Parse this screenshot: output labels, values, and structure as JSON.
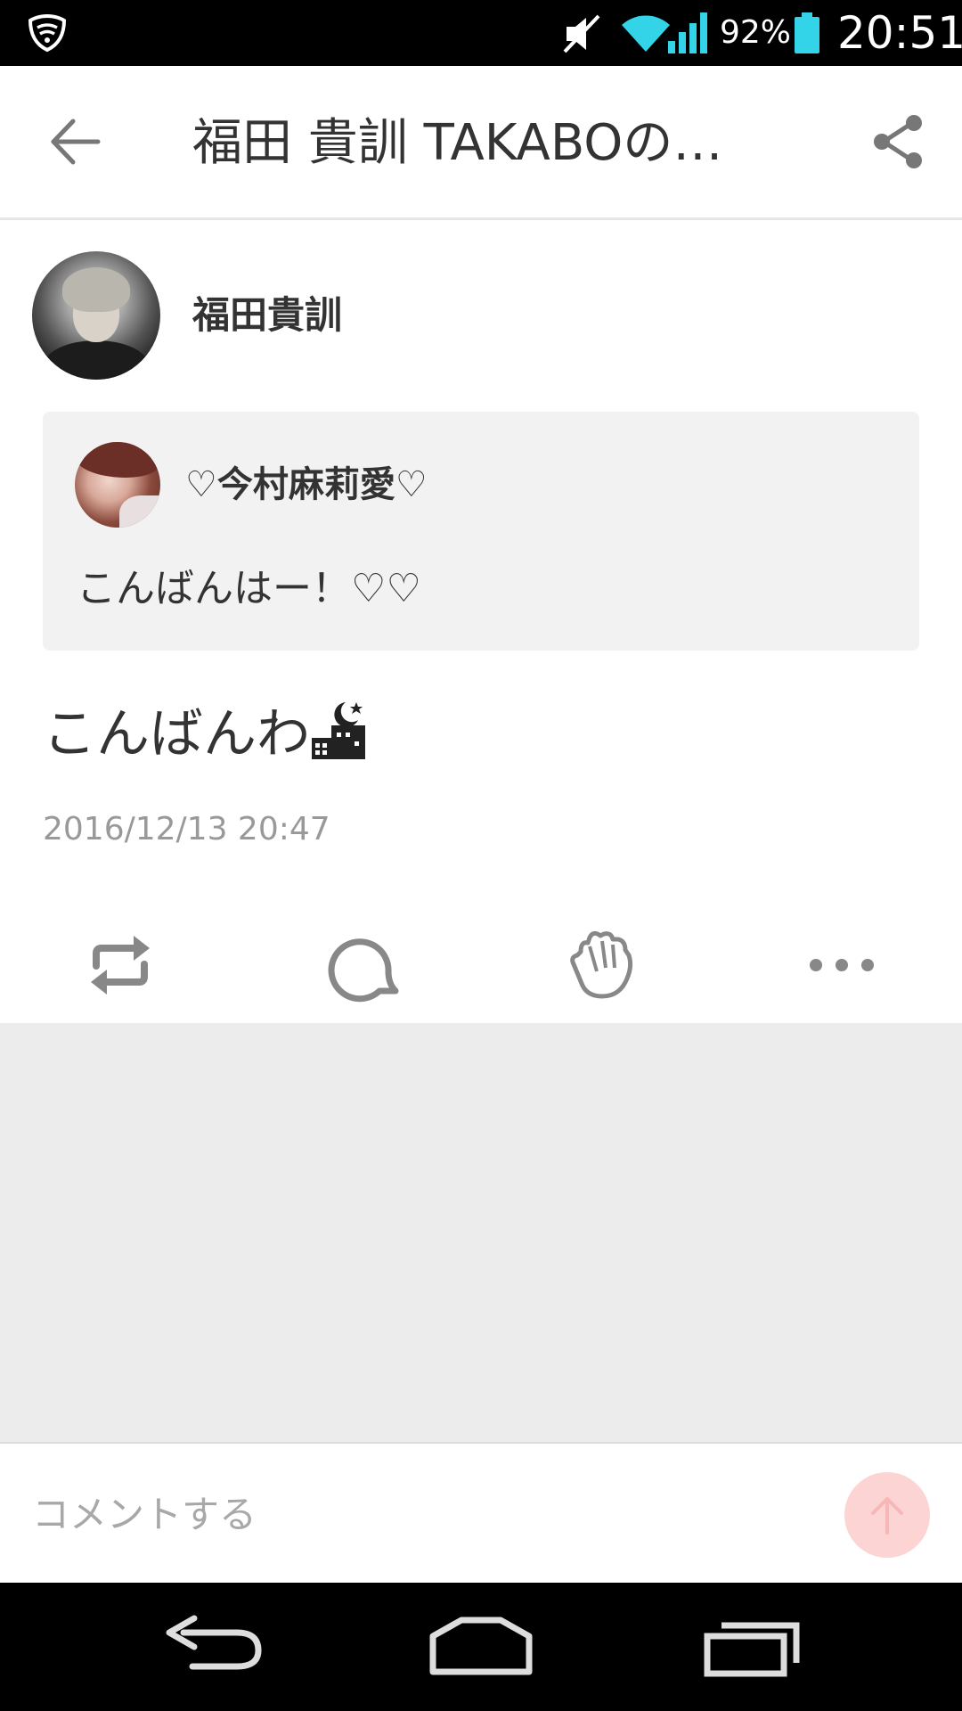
{
  "status_bar": {
    "battery_percent": "92%",
    "time": "20:51",
    "icons": [
      "shield-icon",
      "mute-icon",
      "wifi-icon",
      "signal-icon",
      "battery-icon"
    ]
  },
  "app_bar": {
    "title": "福田 貴訓  TAKABOの…",
    "back_icon": "arrow-left-icon",
    "share_icon": "share-icon"
  },
  "post": {
    "author_name": "福田貴訓",
    "quote": {
      "name": "♡今村麻莉愛♡",
      "text": "こんばんはー！♡♡"
    },
    "text": "こんばんわ",
    "emoji": "night-city-icon",
    "date": "2016/12/13 20:47"
  },
  "actions": [
    {
      "name": "repost",
      "icon": "repost-icon"
    },
    {
      "name": "comment",
      "icon": "comment-icon"
    },
    {
      "name": "clap",
      "icon": "clap-icon"
    },
    {
      "name": "more",
      "icon": "more-icon"
    }
  ],
  "comment_bar": {
    "placeholder": "コメントする",
    "send_icon": "arrow-up-icon"
  },
  "nav_bar": {
    "icons": [
      "nav-back-icon",
      "nav-home-icon",
      "nav-recent-icon"
    ]
  },
  "colors": {
    "status_bar_bg": "#000000",
    "accent_cyan": "#33d4e8",
    "send_button": "#fcd4d4",
    "gray_area": "#ececec",
    "quote_bg": "#f2f2f2"
  }
}
